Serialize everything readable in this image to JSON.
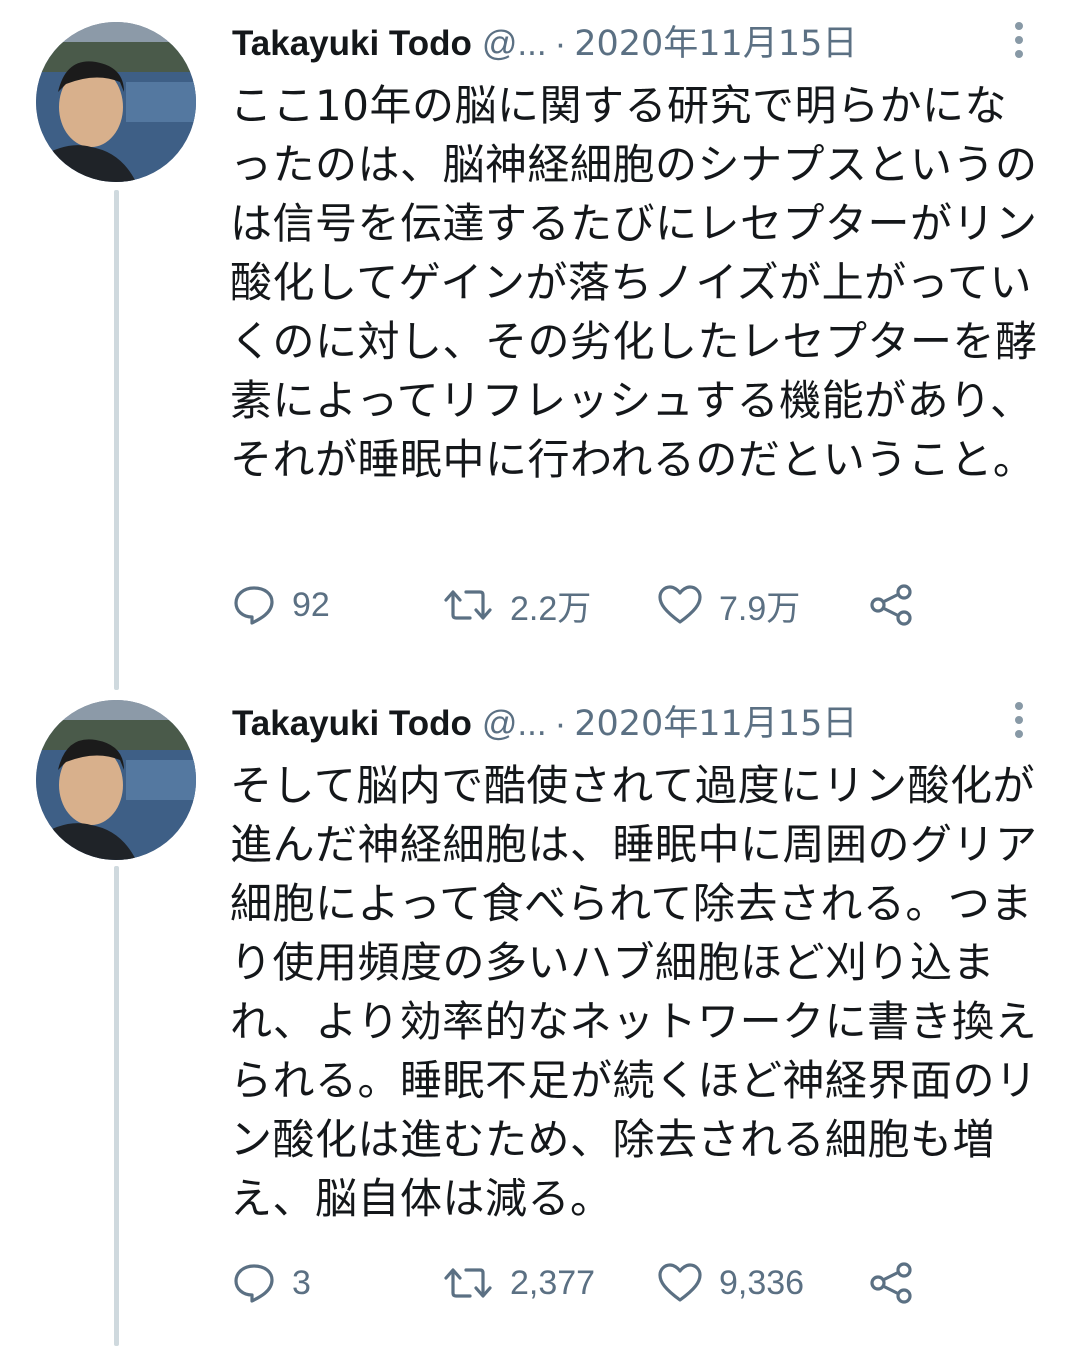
{
  "tweets": [
    {
      "name": "Takayuki Todo",
      "handle": "@...",
      "separator": "·",
      "date": "2020年11月15日",
      "text": "ここ10年の脳に関する研究で明らかになったのは、脳神経細胞のシナプスというのは信号を伝達するたびにレセプターがリン酸化してゲインが落ちノイズが上がっていくのに対し、その劣化したレセプターを酵素によってリフレッシュする機能があり、それが睡眠中に行われるのだということ。",
      "replies": "92",
      "retweets": "2.2万",
      "likes": "7.9万"
    },
    {
      "name": "Takayuki Todo",
      "handle": "@...",
      "separator": "·",
      "date": "2020年11月15日",
      "text": "そして脳内で酷使されて過度にリン酸化が進んだ神経細胞は、睡眠中に周囲のグリア細胞によって食べられて除去される。つまり使用頻度の多いハブ細胞ほど刈り込まれ、より効率的なネットワークに書き換えられる。睡眠不足が続くほど神経界面のリン酸化は進むため、除去される細胞も増え、脳自体は減る。",
      "replies": "3",
      "retweets": "2,377",
      "likes": "9,336"
    }
  ],
  "icons": {
    "reply": "speech-bubble",
    "retweet": "retweet-arrows",
    "like": "heart-outline",
    "share": "share-nodes",
    "more": "vertical-ellipsis"
  },
  "colors": {
    "text": "#14171a",
    "secondary": "#5b7083",
    "thread_line": "#cfd9de"
  }
}
